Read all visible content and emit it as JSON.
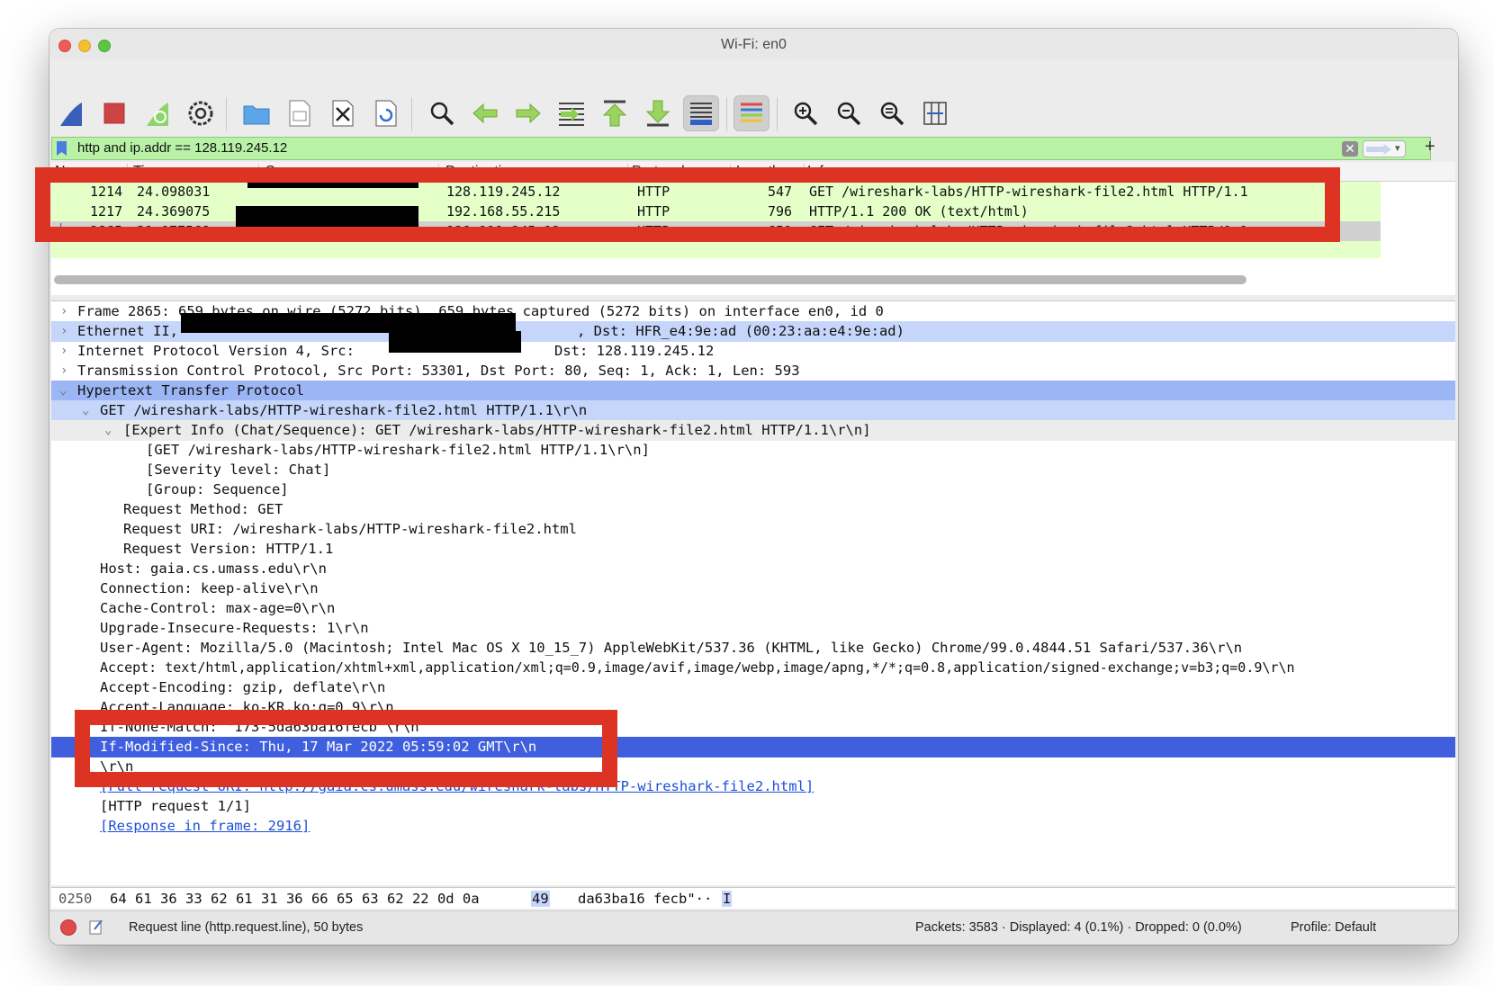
{
  "window": {
    "title": "Wi-Fi: en0"
  },
  "toolbar": {
    "icons": [
      "shark-fin-start-icon",
      "stop-square-icon",
      "restart-fin-icon",
      "capture-options-gear-icon",
      "open-folder-icon",
      "save-file-icon",
      "close-file-icon",
      "reload-file-icon",
      "find-magnifier-icon",
      "back-arrow-icon",
      "forward-arrow-icon",
      "go-to-packet-icon",
      "first-packet-icon",
      "last-packet-icon",
      "autoscroll-icon",
      "colorize-icon",
      "zoom-in-icon",
      "zoom-out-icon",
      "normal-size-icon",
      "resize-columns-icon"
    ]
  },
  "filter": {
    "text": "http and ip.addr == 128.119.245.12",
    "add_label": "+"
  },
  "packet_list": {
    "columns": [
      "No.",
      "Time",
      "Source",
      "Destination",
      "Protocol",
      "Length",
      "Info"
    ],
    "rows": [
      {
        "no": "1214",
        "time": "24.098031",
        "dst": "128.119.245.12",
        "proto": "HTTP",
        "len": "547",
        "info": "GET /wireshark-labs/HTTP-wireshark-file2.html HTTP/1.1"
      },
      {
        "no": "1217",
        "time": "24.369075",
        "dst": "192.168.55.215",
        "proto": "HTTP",
        "len": "796",
        "info": "HTTP/1.1 200 OK  (text/html)"
      },
      {
        "no": "2865",
        "time": "31.977568",
        "dst": "128.119.245.12",
        "proto": "HTTP",
        "len": "659",
        "info": "GET /wireshark-labs/HTTP-wireshark-file2.html HTTP/1.1"
      }
    ]
  },
  "details": {
    "frame": "Frame 2865: 659 bytes on wire (5272 bits), 659 bytes captured (5272 bits) on interface en0, id 0",
    "eth_prefix": "Ethernet II,",
    "eth_dst": ", Dst: HFR_e4:9e:ad (00:23:aa:e4:9e:ad)",
    "ip_prefix": "Internet Protocol Version 4, Src:",
    "ip_dst": "Dst: 128.119.245.12",
    "tcp": "Transmission Control Protocol, Src Port: 53301, Dst Port: 80, Seq: 1, Ack: 1, Len: 593",
    "http": "Hypertext Transfer Protocol",
    "get_line": "GET /wireshark-labs/HTTP-wireshark-file2.html HTTP/1.1\\r\\n",
    "expert": "[Expert Info (Chat/Sequence): GET /wireshark-labs/HTTP-wireshark-file2.html HTTP/1.1\\r\\n]",
    "expert_get": "[GET /wireshark-labs/HTTP-wireshark-file2.html HTTP/1.1\\r\\n]",
    "severity": "[Severity level: Chat]",
    "group": "[Group: Sequence]",
    "req_method": "Request Method: GET",
    "req_uri": "Request URI: /wireshark-labs/HTTP-wireshark-file2.html",
    "req_version": "Request Version: HTTP/1.1",
    "host": "Host: gaia.cs.umass.edu\\r\\n",
    "connection": "Connection: keep-alive\\r\\n",
    "cache": "Cache-Control: max-age=0\\r\\n",
    "upgrade": "Upgrade-Insecure-Requests: 1\\r\\n",
    "ua": "User-Agent: Mozilla/5.0 (Macintosh; Intel Mac OS X 10_15_7) AppleWebKit/537.36 (KHTML, like Gecko) Chrome/99.0.4844.51 Safari/537.36\\r\\n",
    "accept": "Accept: text/html,application/xhtml+xml,application/xml;q=0.9,image/avif,image/webp,image/apng,*/*;q=0.8,application/signed-exchange;v=b3;q=0.9\\r\\n",
    "accept_enc": "Accept-Encoding: gzip, deflate\\r\\n",
    "accept_lang": "Accept-Language: ko-KR,ko;q=0.9\\r\\n",
    "if_none": "If-None-Match: \"173-5da63ba16fecb\"\\r\\n",
    "if_mod": "If-Modified-Since: Thu, 17 Mar 2022 05:59:02 GMT\\r\\n",
    "crlf": "\\r\\n",
    "full_uri": "[Full request URI: http://gaia.cs.umass.edu/wireshark-labs/HTTP-wireshark-file2.html]",
    "http_req": "[HTTP request 1/1]",
    "response": "[Response in frame: 2916]"
  },
  "bytes": {
    "offset": "0250",
    "hex": "64 61 36 33 62 61 31 36  66 65 63 62 22 0d 0a",
    "hex_hl": "49",
    "ascii": "da63ba16 fecb\"··",
    "ascii_hl": "I"
  },
  "status": {
    "field": "Request line (http.request.line), 50 bytes",
    "packets": "Packets: 3583 · Displayed: 4 (0.1%) · Dropped: 0 (0.0%)",
    "profile": "Profile: Default"
  },
  "colors": {
    "accent_selection": "#3f5fde",
    "annotation_red": "#dc3323",
    "filter_ok": "#b9f2a7"
  }
}
